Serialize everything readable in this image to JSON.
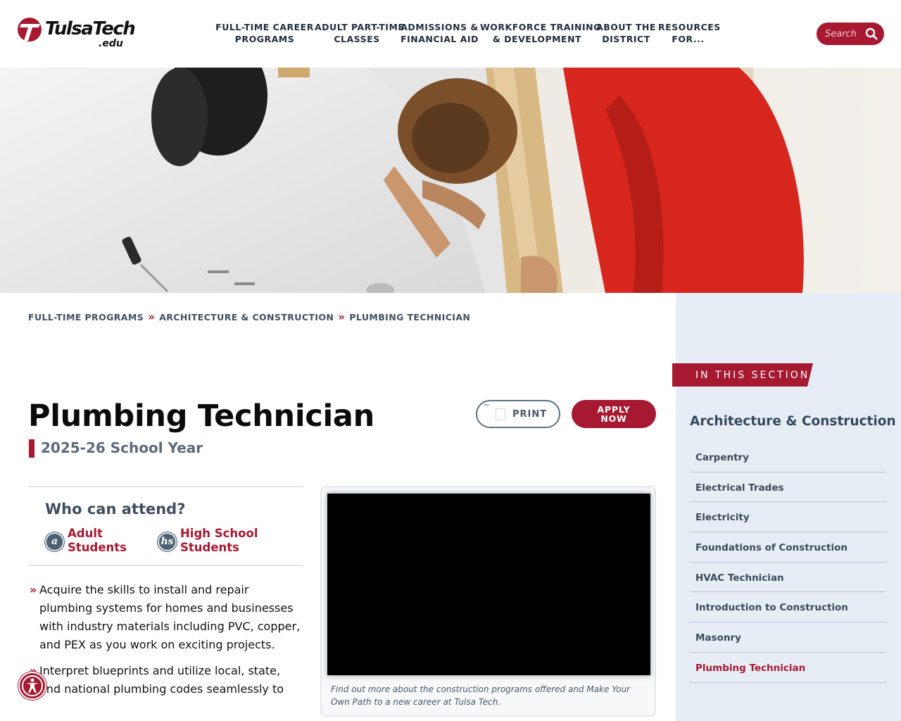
{
  "header": {
    "logo": {
      "name": "TulsaTech",
      "suffix": ".edu"
    },
    "nav": [
      {
        "label": "FULL-TIME CAREER\nPROGRAMS"
      },
      {
        "label": "ADULT PART-TIME\nCLASSES"
      },
      {
        "label": "ADMISSIONS &\nFINANCIAL AID"
      },
      {
        "label": "WORKFORCE TRAINING\n& DEVELOPMENT"
      },
      {
        "label": "ABOUT THE\nDISTRICT"
      },
      {
        "label": "RESOURCES\nFOR..."
      }
    ],
    "search": {
      "placeholder": "Search",
      "icon": "magnifier-icon"
    }
  },
  "hero": {
    "image": "students installing bathtub plumbing"
  },
  "breadcrumb": {
    "items": [
      "FULL-TIME PROGRAMS",
      "ARCHITECTURE & CONSTRUCTION",
      "PLUMBING TECHNICIAN"
    ],
    "separator": "»"
  },
  "page": {
    "title": "Plumbing Technician",
    "year": "2025-26 School Year",
    "print_label": "PRINT",
    "apply_label": "APPLY\nNOW"
  },
  "attend": {
    "heading": "Who can attend?",
    "audiences": [
      {
        "badge": "a",
        "label": "Adult\nStudents"
      },
      {
        "badge": "hs",
        "label": "High School\nStudents"
      }
    ]
  },
  "bullets": [
    "Acquire the skills to install and repair plumbing systems for homes and businesses with industry materials including PVC, copper, and PEX as you work on exciting projects.",
    "Interpret blueprints and utilize local, state, and national plumbing codes seamlessly to"
  ],
  "video": {
    "caption": "Find out more about the construction programs offered and Make Your Own Path to a new career at Tulsa Tech."
  },
  "sidebar": {
    "section_label": "IN THIS SECTION",
    "title": "Architecture & Construction",
    "items": [
      {
        "label": "Carpentry"
      },
      {
        "label": "Electrical Trades"
      },
      {
        "label": "Electricity"
      },
      {
        "label": "Foundations of Construction"
      },
      {
        "label": "HVAC Technician"
      },
      {
        "label": "Introduction to Construction"
      },
      {
        "label": "Masonry"
      },
      {
        "label": "Plumbing Technician",
        "active": true
      }
    ]
  },
  "colors": {
    "brand_red": "#a71930",
    "slate": "#3d4e5f",
    "sidebar_bg": "#e7edf5"
  }
}
